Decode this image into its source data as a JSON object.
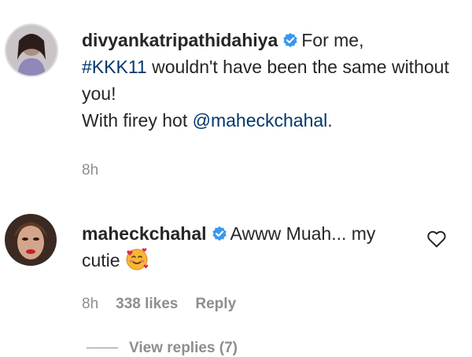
{
  "comments": [
    {
      "username": "divyankatripathidahiya",
      "verified": true,
      "text_parts": {
        "intro": "For me,",
        "hashtag": "#KKK11",
        "middle": " wouldn't have been the same without you!",
        "line2_prefix": "With firey hot ",
        "mention": "@maheckchahal",
        "line2_suffix": "."
      },
      "time": "8h",
      "avatar_icon": "profile-photo"
    },
    {
      "username": "maheckchahal",
      "verified": true,
      "text_parts": {
        "body": "Awww Muah... my cutie"
      },
      "emoji_icon": "smiling-face-with-hearts-emoji",
      "time": "8h",
      "likes": "338 likes",
      "reply_label": "Reply",
      "like_icon": "heart-outline-icon",
      "avatar_icon": "profile-photo"
    }
  ],
  "view_replies": "View replies (7)",
  "colors": {
    "text": "#262626",
    "muted": "#8e8e8e",
    "link": "#00376b",
    "verified": "#3897f0"
  }
}
